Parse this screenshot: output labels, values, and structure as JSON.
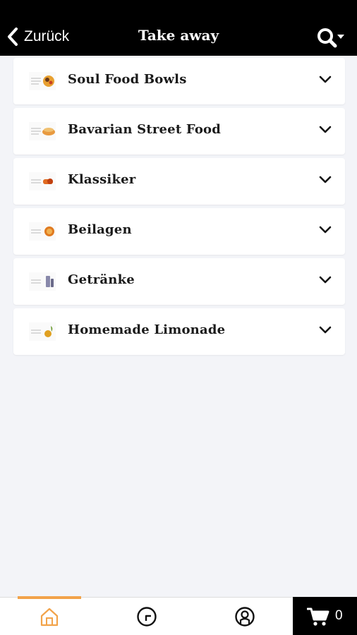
{
  "header": {
    "back_label": "Zurück",
    "title": "Take away"
  },
  "categories": [
    {
      "label": "Soul Food Bowls",
      "icon": "bowl-thumbnail-icon",
      "accent": "#e8a030"
    },
    {
      "label": "Bavarian Street Food",
      "icon": "street-food-thumbnail-icon",
      "accent": "#e89a40"
    },
    {
      "label": "Klassiker",
      "icon": "classic-thumbnail-icon",
      "accent": "#e06a20"
    },
    {
      "label": "Beilagen",
      "icon": "sides-thumbnail-icon",
      "accent": "#e07a20"
    },
    {
      "label": "Getränke",
      "icon": "drinks-thumbnail-icon",
      "accent": "#8888aa"
    },
    {
      "label": "Homemade Limonade",
      "icon": "lemonade-thumbnail-icon",
      "accent": "#e0a020"
    }
  ],
  "tabbar": {
    "tabs": [
      {
        "name": "home",
        "icon": "home-icon",
        "active": true
      },
      {
        "name": "history",
        "icon": "clock-icon",
        "active": false
      },
      {
        "name": "account",
        "icon": "user-icon",
        "active": false
      }
    ],
    "cart_count": "0"
  },
  "colors": {
    "header_bg": "#000000",
    "accent": "#f2a34a",
    "page_bg": "#f3f4f8"
  }
}
